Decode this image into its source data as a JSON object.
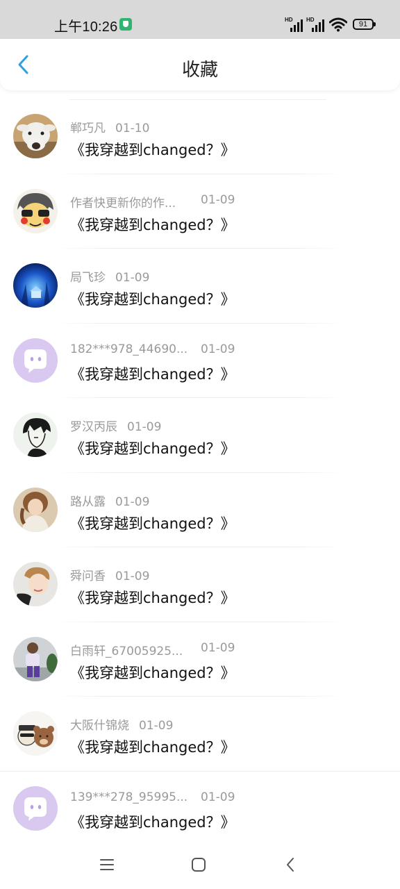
{
  "status_bar": {
    "time": "上午10:26",
    "battery": "91",
    "signal_label_1": "HD",
    "signal_label_2": "HD"
  },
  "header": {
    "title": "收藏",
    "back_icon": "chevron-left-icon",
    "accent_color": "#2f9fe0"
  },
  "items": [
    {
      "name": "郸巧凡",
      "date": "01-10",
      "message": "《我穿越到changed？》",
      "avatar": "goat-photo"
    },
    {
      "name": "作者快更新你的作...",
      "date": "01-09",
      "message": "《我穿越到changed？》",
      "avatar": "cartoon-face"
    },
    {
      "name": "局飞珍",
      "date": "01-09",
      "message": "《我穿越到changed？》",
      "avatar": "blue-night-scene"
    },
    {
      "name": "182***978_44690...",
      "date": "01-09",
      "message": "《我穿越到changed？》",
      "avatar": "default-chat-avatar"
    },
    {
      "name": "罗汉丙辰",
      "date": "01-09",
      "message": "《我穿越到changed？》",
      "avatar": "anime-sketch"
    },
    {
      "name": "路从露",
      "date": "01-09",
      "message": "《我穿越到changed？》",
      "avatar": "doll-photo"
    },
    {
      "name": "舜问香",
      "date": "01-09",
      "message": "《我穿越到changed？》",
      "avatar": "child-photo"
    },
    {
      "name": "白雨轩_67005925...",
      "date": "01-09",
      "message": "《我穿越到changed？》",
      "avatar": "boy-photo"
    },
    {
      "name": "大阪什锦烧",
      "date": "01-09",
      "message": "《我穿越到changed？》",
      "avatar": "bears-cartoon"
    },
    {
      "name": "139***278_95995...",
      "date": "01-09",
      "message": "《我穿越到changed？》",
      "avatar": "default-chat-avatar"
    }
  ],
  "nav_bar": {
    "menu_icon": "menu-icon",
    "home_icon": "home-square-icon",
    "back_icon": "back-triangle-icon"
  }
}
